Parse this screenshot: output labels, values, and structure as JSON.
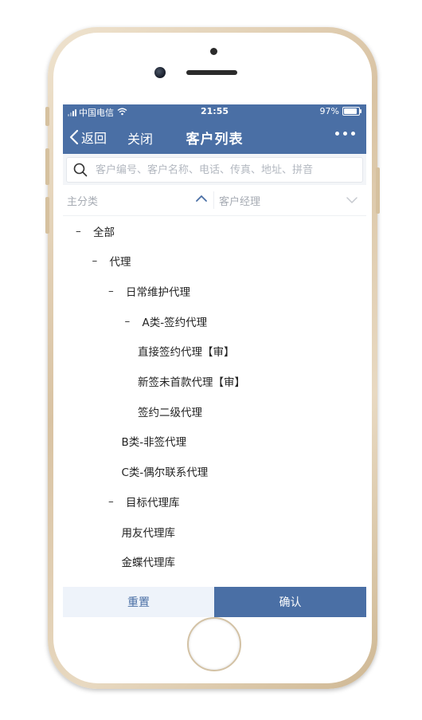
{
  "status": {
    "carrier": "中国电信",
    "time": "21:55",
    "battery": "97%",
    "battery_level": 0.97
  },
  "nav": {
    "back_label": "返回",
    "close_label": "关闭",
    "title": "客户列表"
  },
  "search": {
    "placeholder": "客户编号、客户名称、电话、传真、地址、拼音"
  },
  "filters": {
    "main_category": "主分类",
    "account_manager": "客户经理"
  },
  "tree": [
    {
      "label": "全部",
      "level": 0,
      "collapsible": true
    },
    {
      "label": "代理",
      "level": 1,
      "collapsible": true
    },
    {
      "label": "日常维护代理",
      "level": 2,
      "collapsible": true
    },
    {
      "label": "A类-签约代理",
      "level": 3,
      "collapsible": true
    },
    {
      "label": "直接签约代理【审】",
      "level": 4,
      "collapsible": false
    },
    {
      "label": "新签未首款代理【审】",
      "level": 4,
      "collapsible": false
    },
    {
      "label": "签约二级代理",
      "level": 4,
      "collapsible": false
    },
    {
      "label": "B类-非签代理",
      "level": 3,
      "collapsible": false
    },
    {
      "label": "C类-偶尔联系代理",
      "level": 3,
      "collapsible": false
    },
    {
      "label": "目标代理库",
      "level": 2,
      "collapsible": true
    },
    {
      "label": "用友代理库",
      "level": 3,
      "collapsible": false
    },
    {
      "label": "金蝶代理库",
      "level": 3,
      "collapsible": false
    }
  ],
  "buttons": {
    "reset": "重置",
    "confirm": "确认"
  },
  "colors": {
    "primary": "#4a6fa5",
    "reset_bg": "#eef3fa"
  }
}
